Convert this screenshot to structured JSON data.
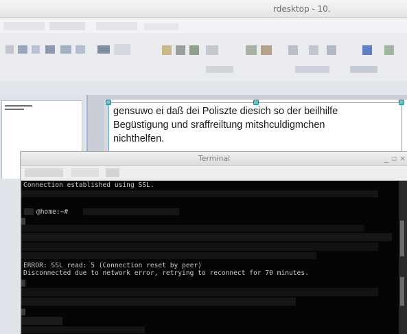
{
  "rdesktop": {
    "title": "rdesktop - 10."
  },
  "document": {
    "lines": [
      "gensuwo ei daß dei Poliszte diesich so der beilhilfe",
      "Begüstigung und sraffreiltung mitshculdigmchen",
      "nichthelfen."
    ]
  },
  "terminal": {
    "title": "Terminal",
    "controls": [
      "_",
      "▫",
      "×"
    ],
    "lines": {
      "ssl": "Connection established using SSL.",
      "prompt": "@home:~#",
      "error": "ERROR: SSL_read: 5 (Connection reset by peer)",
      "disconnected": "Disconnected due to network error, retrying to reconnect for 70 minutes."
    }
  },
  "colors": {
    "terminal_bg": "#050505",
    "terminal_fg": "#c9c9c9",
    "selection_border": "#6aa6c8"
  }
}
